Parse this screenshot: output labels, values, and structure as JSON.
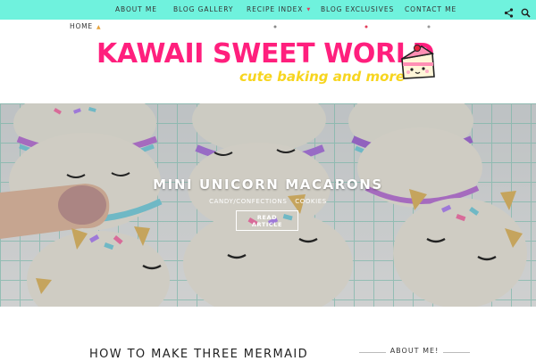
{
  "nav": {
    "items": [
      {
        "label": "ABOUT ME"
      },
      {
        "label": "BLOG GALLERY"
      },
      {
        "label": "RECIPE INDEX"
      },
      {
        "label": "BLOG EXCLUSIVES"
      },
      {
        "label": "CONTACT ME"
      }
    ],
    "icons": [
      "share-icon",
      "search-icon"
    ]
  },
  "subnav": {
    "home_label": "HOME"
  },
  "logo": {
    "title": "KAWAII SWEET WORLD",
    "tagline": "cute baking and more"
  },
  "hero": {
    "title": "MINI UNICORN MACARONS",
    "categories": [
      "CANDY/CONFECTIONS",
      "COOKIES"
    ],
    "button_label_1": "READ",
    "button_label_2": "ARTICLE"
  },
  "post": {
    "title": "HOW TO MAKE THREE MERMAID"
  },
  "sidebar": {
    "widget_title": "ABOUT ME!"
  },
  "colors": {
    "topbar": "#6ff2dd",
    "brand_pink": "#ff1f7d",
    "brand_yellow": "#f7d51f"
  }
}
